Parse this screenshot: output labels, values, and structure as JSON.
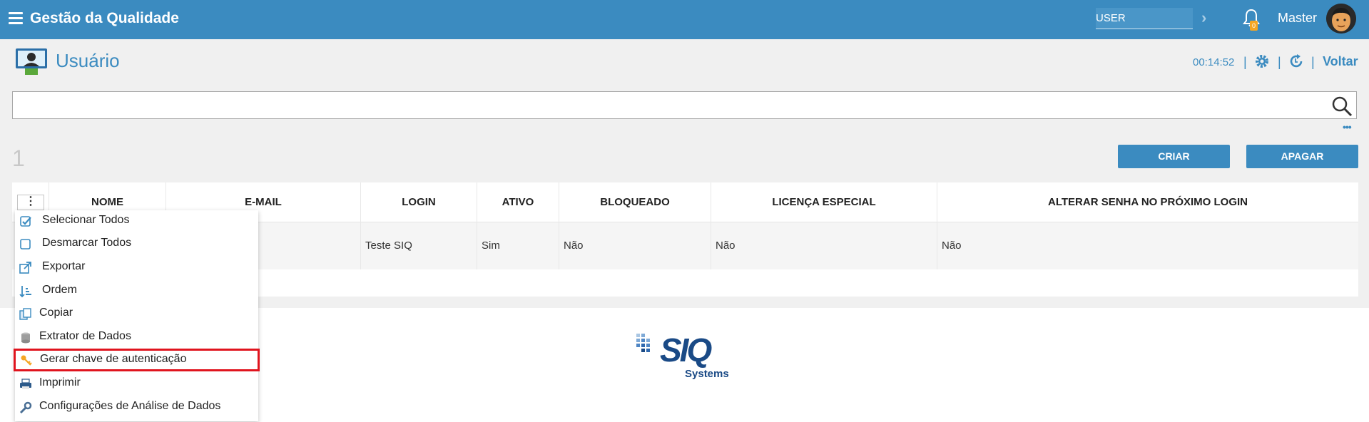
{
  "header": {
    "app_title": "Gestão da Qualidade",
    "user_field": "USER",
    "notification_count": "0",
    "user_name": "Master"
  },
  "page": {
    "title": "Usuário",
    "timer": "00:14:52",
    "voltar_label": "Voltar",
    "search_placeholder": "",
    "record_count": "1"
  },
  "actions": {
    "criar": "CRIAR",
    "apagar": "APAGAR"
  },
  "table": {
    "columns": [
      "NOME",
      "E-MAIL",
      "LOGIN",
      "ATIVO",
      "BLOQUEADO",
      "LICENÇA ESPECIAL",
      "ALTERAR SENHA NO PRÓXIMO LOGIN"
    ],
    "rows": [
      {
        "login": "Teste SIQ",
        "ativo": "Sim",
        "bloqueado": "Não",
        "licenca": "Não",
        "alterar_senha": "Não"
      }
    ]
  },
  "menu": {
    "items": [
      {
        "label": "Selecionar Todos",
        "icon": "checkbox-checked-icon"
      },
      {
        "label": "Desmarcar Todos",
        "icon": "checkbox-empty-icon"
      },
      {
        "label": "Exportar",
        "icon": "export-icon"
      },
      {
        "label": "Ordem",
        "icon": "sort-icon"
      },
      {
        "label": "Copiar",
        "icon": "copy-icon"
      },
      {
        "label": "Extrator de Dados",
        "icon": "database-icon"
      },
      {
        "label": "Gerar chave de autenticação",
        "icon": "key-icon"
      },
      {
        "label": "Imprimir",
        "icon": "printer-icon"
      },
      {
        "label": "Configurações de Análise de Dados",
        "icon": "wrench-icon"
      }
    ]
  },
  "logo": {
    "brand": "SIQ",
    "sub": "Systems"
  },
  "colors": {
    "primary": "#3b8bc0",
    "highlight_border": "#e0141e",
    "logo": "#1a4a86"
  }
}
